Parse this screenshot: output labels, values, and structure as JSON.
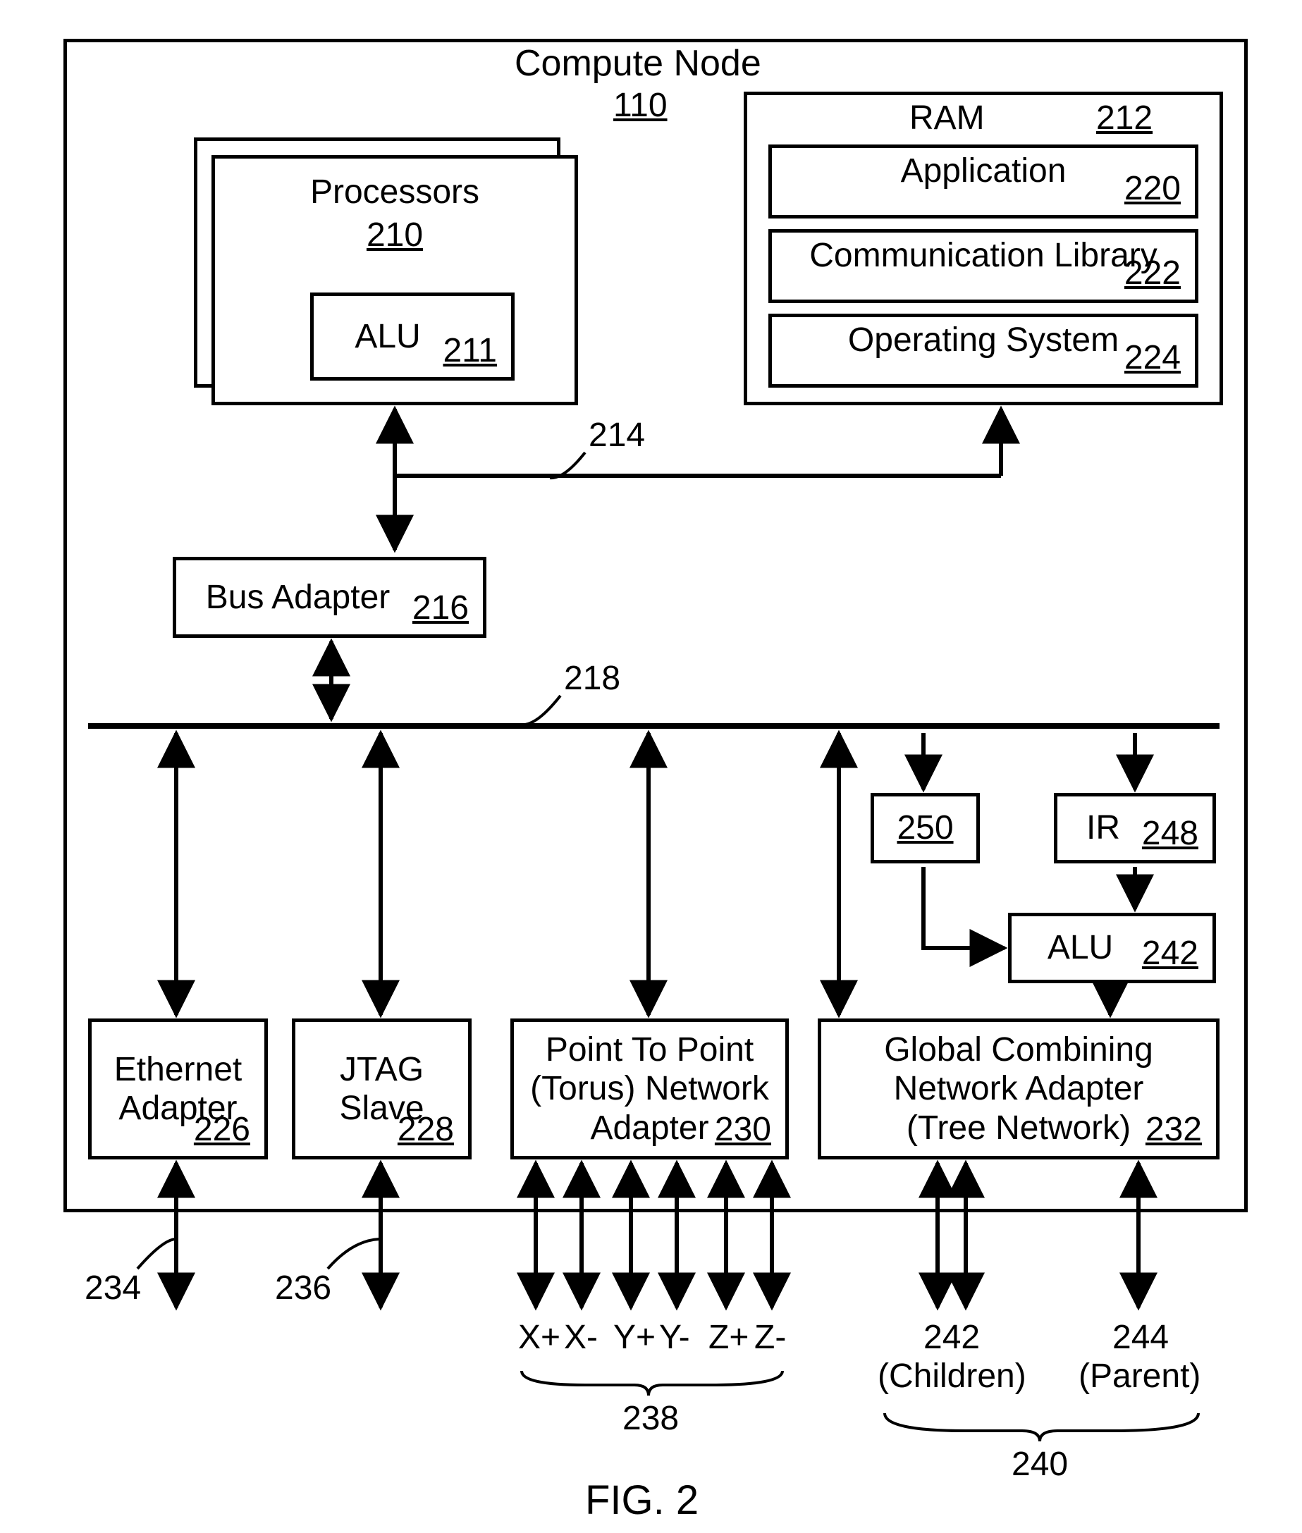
{
  "title": "Compute Node",
  "title_ref": "110",
  "figure_label": "FIG. 2",
  "blocks": {
    "processors": {
      "label": "Processors",
      "ref": "210"
    },
    "alu_proc": {
      "label": "ALU",
      "ref": "211"
    },
    "ram": {
      "label": "RAM",
      "ref": "212"
    },
    "application": {
      "label": "Application",
      "ref": "220"
    },
    "commlib": {
      "label": "Communication Library",
      "ref": "222"
    },
    "os": {
      "label": "Operating System",
      "ref": "224"
    },
    "busadapter": {
      "label": "Bus Adapter",
      "ref": "216"
    },
    "ethernet": {
      "label": "Ethernet\nAdapter",
      "ref": "226"
    },
    "jtag": {
      "label": "JTAG\nSlave",
      "ref": "228"
    },
    "p2p": {
      "label": "Point To Point\n(Torus) Network\nAdapter",
      "ref": "230"
    },
    "global": {
      "label": "Global Combining\nNetwork Adapter\n(Tree Network)",
      "ref": "232"
    },
    "b250": {
      "ref": "250"
    },
    "ir": {
      "label": "IR",
      "ref": "248"
    },
    "alu_glob": {
      "label": "ALU",
      "ref": "242"
    }
  },
  "bus_labels": {
    "bus214": "214",
    "bus218": "218"
  },
  "ports": {
    "xplus": "X+",
    "xminus": "X-",
    "yplus": "Y+",
    "yminus": "Y-",
    "zplus": "Z+",
    "zminus": "Z-",
    "torus_ref": "238",
    "children_ref": "242",
    "children_lbl": "(Children)",
    "parent_ref": "244",
    "parent_lbl": "(Parent)",
    "tree_ref": "240",
    "eth_ref": "234",
    "jtag_ref": "236"
  }
}
